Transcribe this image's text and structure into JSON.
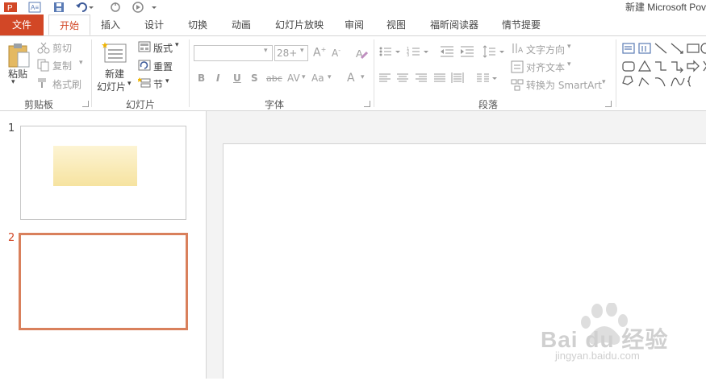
{
  "window": {
    "title": "新建 Microsoft Pov"
  },
  "tabs": [
    {
      "label": "文件"
    },
    {
      "label": "开始"
    },
    {
      "label": "插入"
    },
    {
      "label": "设计"
    },
    {
      "label": "切换"
    },
    {
      "label": "动画"
    },
    {
      "label": "幻灯片放映"
    },
    {
      "label": "审阅"
    },
    {
      "label": "视图"
    },
    {
      "label": "福昕阅读器"
    },
    {
      "label": "情节提要"
    }
  ],
  "ribbon": {
    "clipboard": {
      "group_label": "剪贴板",
      "paste": "粘贴",
      "cut": "剪切",
      "copy": "复制",
      "format_painter": "格式刷"
    },
    "slides": {
      "group_label": "幻灯片",
      "new_slide_line1": "新建",
      "new_slide_line2": "幻灯片",
      "layout": "版式",
      "reset": "重置",
      "section": "节"
    },
    "font": {
      "group_label": "字体",
      "font_size": "28+",
      "bold": "B",
      "italic": "I",
      "underline": "U",
      "shadow": "S",
      "strikethrough": "abc",
      "spacing": "AV",
      "case": "Aa",
      "font_color": "A"
    },
    "paragraph": {
      "group_label": "段落",
      "text_direction": "文字方向",
      "align_text": "对齐文本",
      "convert_smartart": "转换为 SmartArt"
    }
  },
  "slides": [
    {
      "number": "1"
    },
    {
      "number": "2"
    }
  ],
  "watermark": {
    "logo": "Bai du 经验",
    "url": "jingyan.baidu.com"
  },
  "colors": {
    "accent": "#d24726",
    "selected_border": "#d9805c"
  }
}
